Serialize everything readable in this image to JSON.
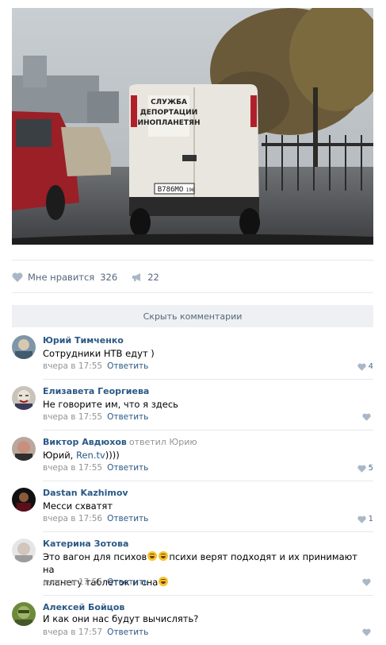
{
  "post": {
    "photo": {
      "van_text_line1": "СЛУЖБА",
      "van_text_line2": "ДЕПОРТАЦИИ",
      "van_text_line3": "ИНОПЛАНЕТЯН",
      "plate": "В786МО",
      "plate_region": "196"
    },
    "likes_label": "Мне нравится",
    "likes_count": "326",
    "shares_count": "22"
  },
  "hide_comments_label": "Скрыть комментарии",
  "reply_label": "Ответить",
  "colors": {
    "link": "#2a5885",
    "muted": "#939393",
    "separator": "#e7e8ec",
    "button_bg": "#eef0f3"
  },
  "comments": [
    {
      "author": "Юрий Тимченко",
      "reply_to": "",
      "text": "Сотрудники НТВ едут )",
      "time": "вчера в 17:55",
      "likes": "4"
    },
    {
      "author": "Елизавета Георгиева",
      "reply_to": "",
      "text": "Не говорите им, что я здесь",
      "time": "вчера в 17:55",
      "likes": ""
    },
    {
      "author": "Виктор Авдюхов",
      "reply_to": "ответил Юрию",
      "text_prefix": "Юрий, ",
      "text_link": "Ren.tv",
      "text_suffix": "))))",
      "time": "вчера в 17:55",
      "likes": "5"
    },
    {
      "author": "Dastan Kazhimov",
      "reply_to": "",
      "text": "Месси схватят",
      "time": "вчера в 17:56",
      "likes": "1"
    },
    {
      "author": "Катерина Зотова",
      "reply_to": "",
      "text_part1": "Это вагон для психов",
      "text_part2": "психи верят подходят и их принимают на",
      "text_line2": "планету таблеток и сна",
      "time": "вчера в 17:56",
      "likes": ""
    },
    {
      "author": "Алексей Бойцов",
      "reply_to": "",
      "text": "И как они нас будут вычислять?",
      "time": "вчера в 17:57",
      "likes": ""
    }
  ]
}
